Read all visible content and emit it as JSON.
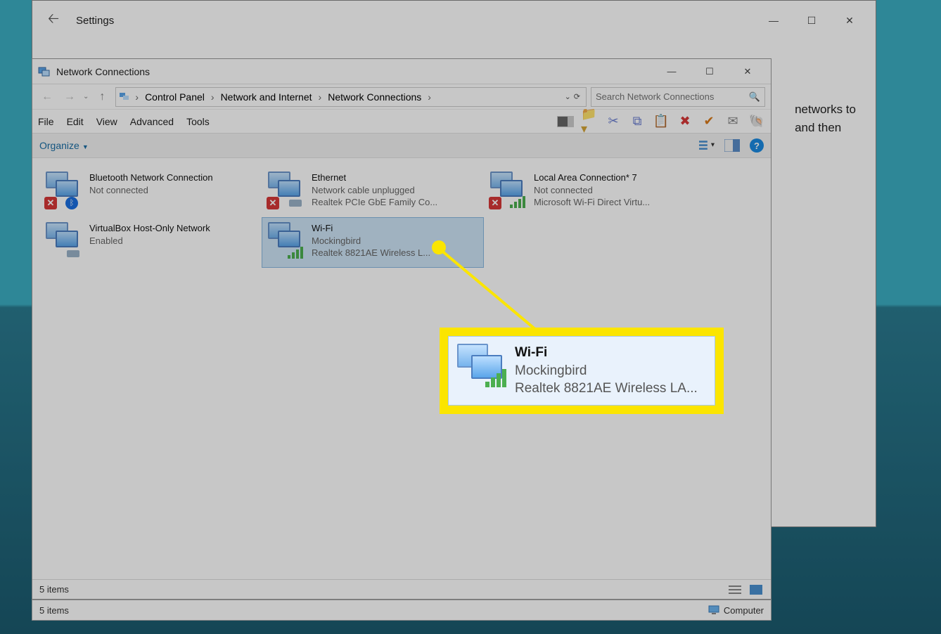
{
  "settings_window": {
    "title": "Settings",
    "body_text_1": "networks to",
    "body_text_2": "and then"
  },
  "nc_window": {
    "title": "Network Connections",
    "breadcrumbs": [
      "Control Panel",
      "Network and Internet",
      "Network Connections"
    ],
    "search_placeholder": "Search Network Connections",
    "menu": [
      "File",
      "Edit",
      "View",
      "Advanced",
      "Tools"
    ],
    "organize": "Organize",
    "status_items": "5 items",
    "connections": [
      {
        "name": "Bluetooth Network Connection",
        "line2": "Not connected",
        "line3": "",
        "icon": "bt-disconnected"
      },
      {
        "name": "Ethernet",
        "line2": "Network cable unplugged",
        "line3": "Realtek PCIe GbE Family Co...",
        "icon": "eth-disconnected"
      },
      {
        "name": "Local Area Connection* 7",
        "line2": "Not connected",
        "line3": "Microsoft Wi-Fi Direct Virtu...",
        "icon": "wifi-disconnected"
      },
      {
        "name": "VirtualBox Host-Only Network",
        "line2": "Enabled",
        "line3": "",
        "icon": "vbox"
      },
      {
        "name": "Wi-Fi",
        "line2": "Mockingbird",
        "line3": "Realtek 8821AE Wireless L...",
        "icon": "wifi-connected",
        "selected": true
      }
    ]
  },
  "callout": {
    "name": "Wi-Fi",
    "line2": "Mockingbird",
    "line3": "Realtek 8821AE Wireless LA..."
  },
  "bottom_status": {
    "text": "5 items",
    "right": "Computer"
  }
}
